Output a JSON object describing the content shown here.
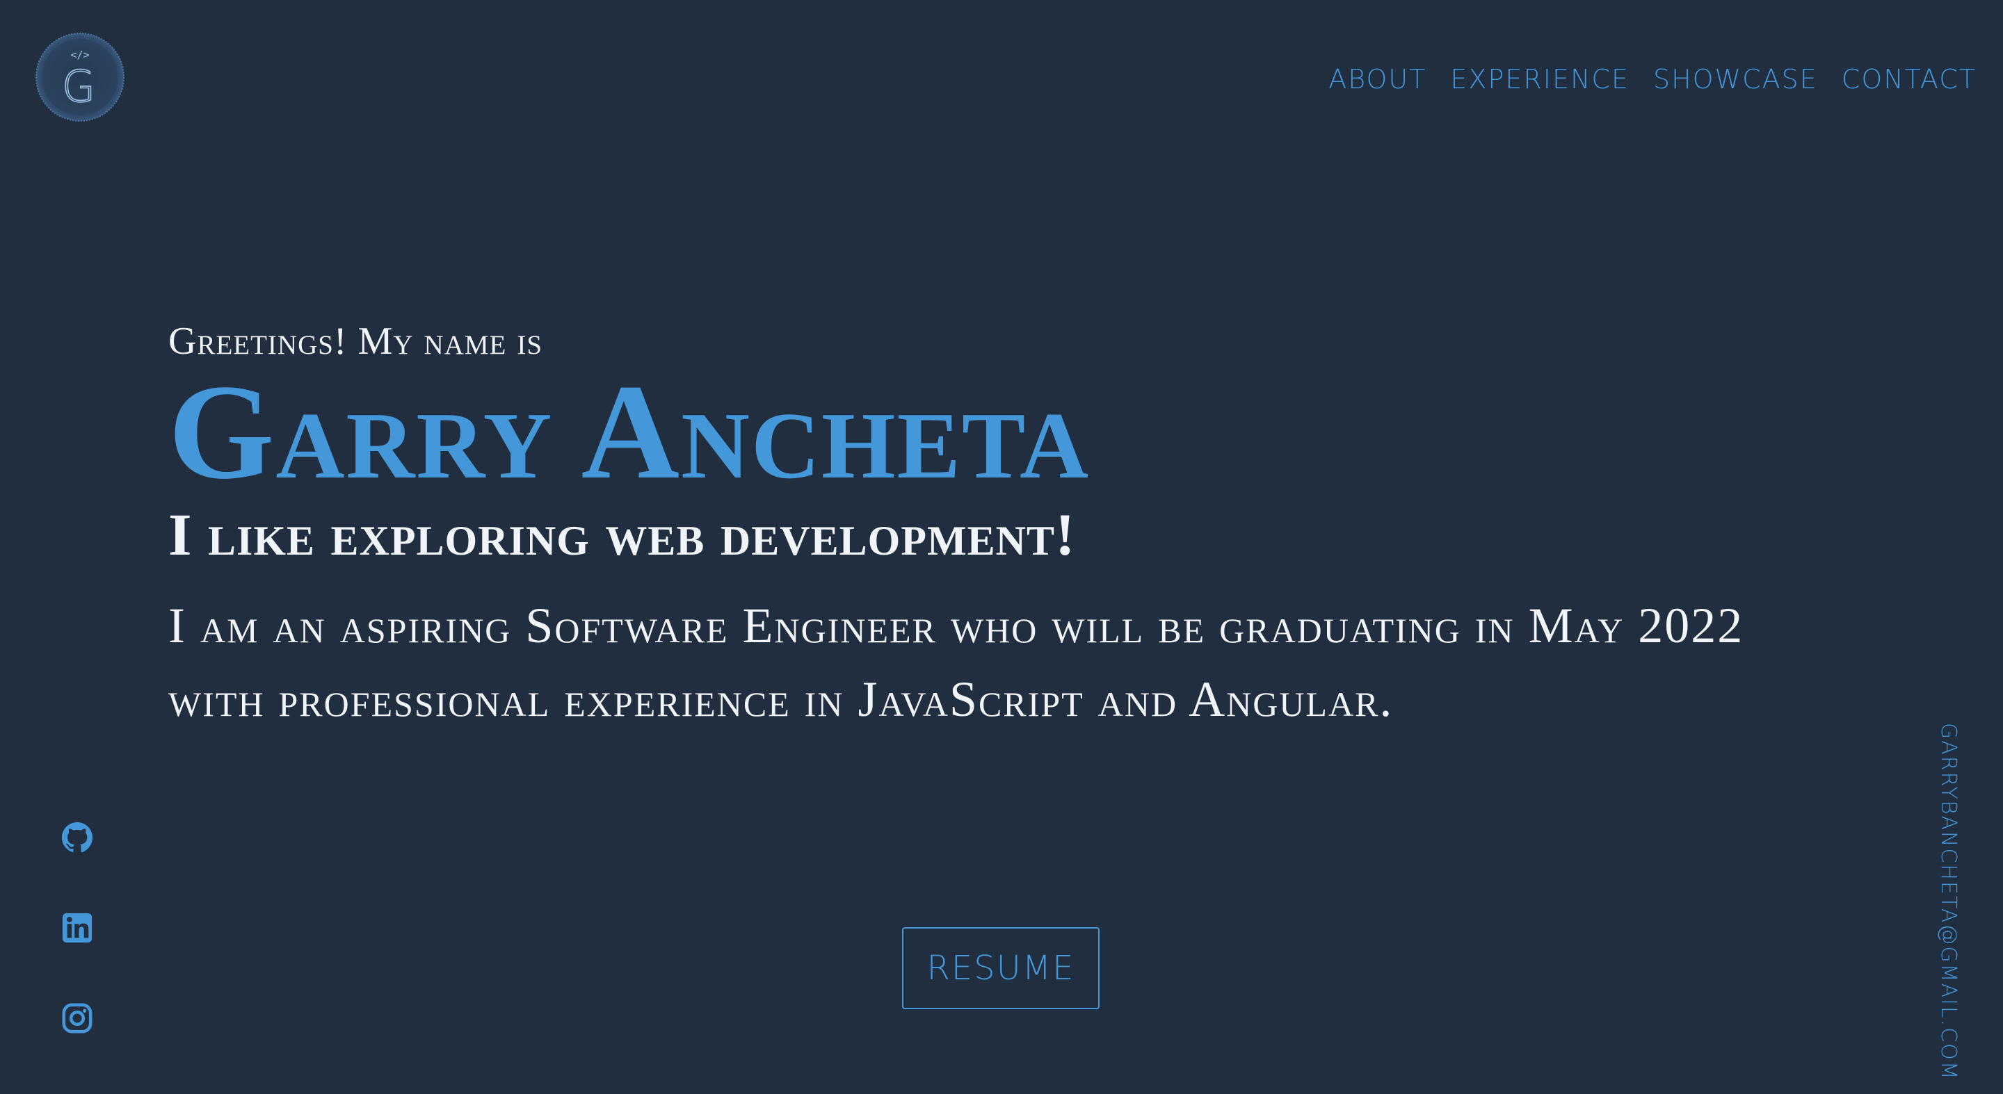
{
  "logo": {
    "icon": "code-g-logo-icon",
    "code_symbol": "</>",
    "letter": "G"
  },
  "nav": {
    "items": [
      {
        "label": "ABOUT"
      },
      {
        "label": "EXPERIENCE"
      },
      {
        "label": "SHOWCASE"
      },
      {
        "label": "CONTACT"
      }
    ]
  },
  "hero": {
    "greeting": "Greetings! My name is",
    "name": "Garry Ancheta",
    "tagline": "I like exploring web development!",
    "bio": "I am an aspiring Software Engineer who will be graduating in May 2022 with professional experience in JavaScript and Angular."
  },
  "resume": {
    "label": "RESUME"
  },
  "social": {
    "icons": [
      "github-icon",
      "linkedin-icon",
      "instagram-icon"
    ]
  },
  "email": {
    "address": "GARRYBANCHETA@GMAIL.COM"
  },
  "colors": {
    "background": "#202e40",
    "accent": "#4497d8",
    "text": "#f1f4f8"
  }
}
